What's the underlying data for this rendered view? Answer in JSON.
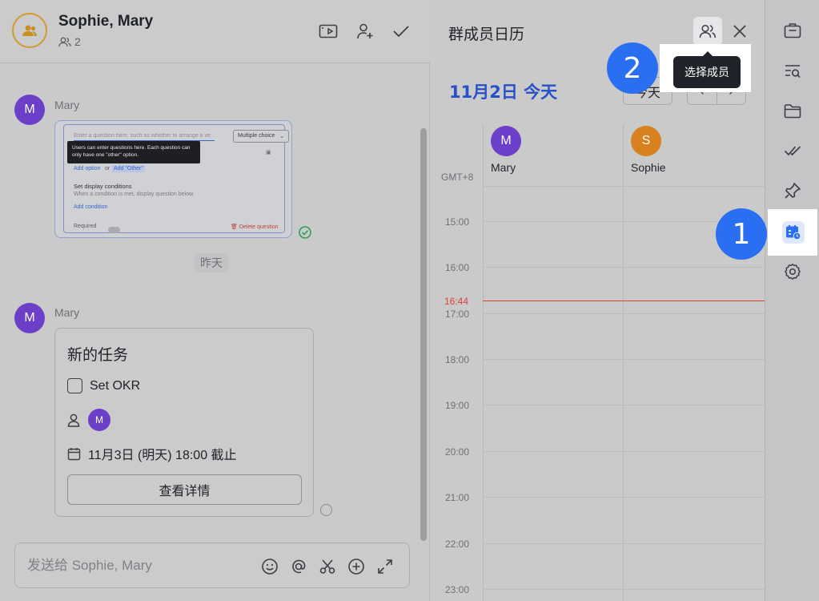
{
  "chat": {
    "title": "Sophie, Mary",
    "member_count": "2",
    "messages": [
      {
        "sender": "Mary",
        "avatar": "M"
      },
      {
        "sender": "Mary",
        "avatar": "M"
      }
    ],
    "screenshot_preview": {
      "question_placeholder": "Enter a question here, such as whether to arrange a ve",
      "select_value": "Multiple choice",
      "tooltip": "Users can enter questions here. Each question can only have one \"other\" option.",
      "add_option": "Add option",
      "or": "or",
      "add_other": "Add \"Other\"",
      "conditions_title": "Set display conditions",
      "conditions_desc": "When a condition is met, display question below.",
      "add_condition": "Add condition",
      "required": "Required",
      "delete_question": "Delete question"
    },
    "date_separator": "昨天",
    "task": {
      "title": "新的任务",
      "item": "Set OKR",
      "assignee_avatar": "M",
      "due": "11月3日 (明天) 18:00 截止",
      "detail_button": "查看详情"
    },
    "composer_placeholder": "发送给 Sophie, Mary"
  },
  "calendar": {
    "title": "群成员日历",
    "tooltip": "选择成员",
    "today_label": "11月2日 今天",
    "today_button": "今天",
    "prev": "‹",
    "next": "›",
    "timezone": "GMT+8",
    "members": [
      {
        "avatar": "M",
        "name": "Mary",
        "color": "#6b3fc7"
      },
      {
        "avatar": "S",
        "name": "Sophie",
        "color": "#d9801f"
      }
    ],
    "hours": [
      "15:00",
      "16:00",
      "17:00",
      "18:00",
      "19:00",
      "20:00",
      "21:00",
      "22:00",
      "23:00"
    ],
    "now_label": "16:44"
  },
  "badges": {
    "step1": "1",
    "step2": "2"
  },
  "colors": {
    "accent": "#2751c9",
    "badge": "#2a6ef2",
    "now_line": "#d8433a"
  }
}
